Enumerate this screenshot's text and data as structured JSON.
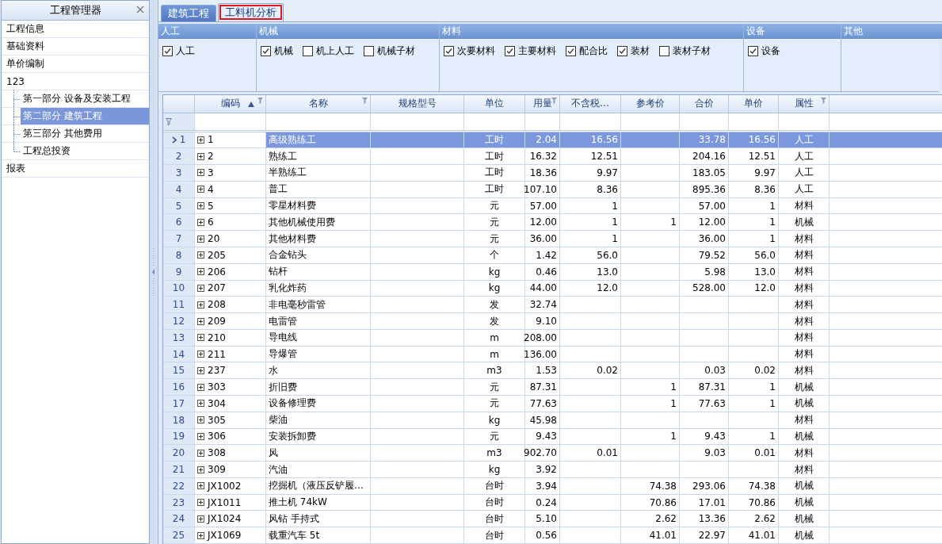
{
  "tree": {
    "title": "工程管理器",
    "items": [
      {
        "label": "工程信息",
        "selected": false
      },
      {
        "label": "基础资料",
        "selected": false
      },
      {
        "label": "单价编制",
        "selected": false
      },
      {
        "label": "123",
        "selected": false,
        "children": [
          {
            "label": "第一部分 设备及安装工程",
            "selected": false
          },
          {
            "label": "第二部分 建筑工程",
            "selected": true
          },
          {
            "label": "第三部分 其他费用",
            "selected": false
          },
          {
            "label": "工程总投资",
            "selected": false
          }
        ]
      },
      {
        "label": "报表",
        "selected": false
      }
    ]
  },
  "tabs": [
    {
      "label": "建筑工程",
      "selected": false,
      "highlighted": false
    },
    {
      "label": "工料机分析",
      "selected": true,
      "highlighted": true
    }
  ],
  "filter_groups": [
    {
      "title": "人工",
      "options": [
        {
          "label": "人工",
          "checked": true
        }
      ]
    },
    {
      "title": "机械",
      "options": [
        {
          "label": "机械",
          "checked": true
        },
        {
          "label": "机上人工",
          "checked": false
        },
        {
          "label": "机械子材",
          "checked": false
        }
      ]
    },
    {
      "title": "材料",
      "options": [
        {
          "label": "次要材料",
          "checked": true
        },
        {
          "label": "主要材料",
          "checked": true
        },
        {
          "label": "配合比",
          "checked": true
        },
        {
          "label": "装材",
          "checked": true
        },
        {
          "label": "装材子材",
          "checked": false
        }
      ]
    },
    {
      "title": "设备",
      "options": [
        {
          "label": "设备",
          "checked": true
        }
      ]
    },
    {
      "title": "其他"
    }
  ],
  "table": {
    "columns": [
      {
        "label": "编码",
        "sorted": true,
        "filter": true
      },
      {
        "label": "名称",
        "sorted": false,
        "filter": true
      },
      {
        "label": "规格型号",
        "sorted": false,
        "filter": false
      },
      {
        "label": "单位",
        "sorted": false,
        "filter": false
      },
      {
        "label": "用量",
        "sorted": false,
        "filter": true
      },
      {
        "label": "不含税…",
        "sorted": false,
        "filter": false
      },
      {
        "label": "参考价",
        "sorted": false,
        "filter": false
      },
      {
        "label": "合价",
        "sorted": false,
        "filter": false
      },
      {
        "label": "单价",
        "sorted": false,
        "filter": false
      },
      {
        "label": "属性",
        "sorted": false,
        "filter": true
      }
    ],
    "rows": [
      {
        "number": "1",
        "selected": true,
        "code": "1",
        "name": "高级熟练工",
        "unit": "工时",
        "quantity": "2.04",
        "price_excl_tax": "16.56",
        "total": "33.78",
        "unit_price": "16.56",
        "attribute": "人工"
      },
      {
        "number": "2",
        "selected": false,
        "code": "2",
        "name": "熟练工",
        "unit": "工时",
        "quantity": "16.32",
        "price_excl_tax": "12.51",
        "total": "204.16",
        "unit_price": "12.51",
        "attribute": "人工"
      },
      {
        "number": "3",
        "selected": false,
        "code": "3",
        "name": "半熟练工",
        "unit": "工时",
        "quantity": "18.36",
        "price_excl_tax": "9.97",
        "total": "183.05",
        "unit_price": "9.97",
        "attribute": "人工"
      },
      {
        "number": "4",
        "selected": false,
        "code": "4",
        "name": "普工",
        "unit": "工时",
        "quantity": "107.10",
        "price_excl_tax": "8.36",
        "total": "895.36",
        "unit_price": "8.36",
        "attribute": "人工"
      },
      {
        "number": "5",
        "selected": false,
        "code": "5",
        "name": "零星材料费",
        "unit": "元",
        "quantity": "57.00",
        "price_excl_tax": "1",
        "total": "57.00",
        "unit_price": "1",
        "attribute": "材料"
      },
      {
        "number": "6",
        "selected": false,
        "code": "6",
        "name": "其他机械使用费",
        "unit": "元",
        "quantity": "12.00",
        "price_excl_tax": "1",
        "reference_price": "1",
        "total": "12.00",
        "unit_price": "1",
        "attribute": "机械"
      },
      {
        "number": "7",
        "selected": false,
        "code": "20",
        "name": "其他材料费",
        "unit": "元",
        "quantity": "36.00",
        "price_excl_tax": "1",
        "total": "36.00",
        "unit_price": "1",
        "attribute": "材料"
      },
      {
        "number": "8",
        "selected": false,
        "code": "205",
        "name": "合金钻头",
        "unit": "个",
        "quantity": "1.42",
        "price_excl_tax": "56.0",
        "total": "79.52",
        "unit_price": "56.0",
        "attribute": "材料"
      },
      {
        "number": "9",
        "selected": false,
        "code": "206",
        "name": "钻杆",
        "unit": "kg",
        "quantity": "0.46",
        "price_excl_tax": "13.0",
        "total": "5.98",
        "unit_price": "13.0",
        "attribute": "材料"
      },
      {
        "number": "10",
        "selected": false,
        "code": "207",
        "name": "乳化炸药",
        "unit": "kg",
        "quantity": "44.00",
        "price_excl_tax": "12.0",
        "total": "528.00",
        "unit_price": "12.0",
        "attribute": "材料"
      },
      {
        "number": "11",
        "selected": false,
        "code": "208",
        "name": "非电毫秒雷管",
        "unit": "发",
        "quantity": "32.74",
        "attribute": "材料"
      },
      {
        "number": "12",
        "selected": false,
        "code": "209",
        "name": "电雷管",
        "unit": "发",
        "quantity": "9.10",
        "attribute": "材料"
      },
      {
        "number": "13",
        "selected": false,
        "code": "210",
        "name": "导电线",
        "unit": "m",
        "quantity": "208.00",
        "attribute": "材料"
      },
      {
        "number": "14",
        "selected": false,
        "code": "211",
        "name": "导爆管",
        "unit": "m",
        "quantity": "136.00",
        "attribute": "材料"
      },
      {
        "number": "15",
        "selected": false,
        "code": "237",
        "name": "水",
        "unit": "m3",
        "quantity": "1.53",
        "price_excl_tax": "0.02",
        "total": "0.03",
        "unit_price": "0.02",
        "attribute": "材料"
      },
      {
        "number": "16",
        "selected": false,
        "code": "303",
        "name": "折旧费",
        "unit": "元",
        "quantity": "87.31",
        "reference_price": "1",
        "total": "87.31",
        "unit_price": "1",
        "attribute": "机械"
      },
      {
        "number": "17",
        "selected": false,
        "code": "304",
        "name": "设备修理费",
        "unit": "元",
        "quantity": "77.63",
        "reference_price": "1",
        "total": "77.63",
        "unit_price": "1",
        "attribute": "机械"
      },
      {
        "number": "18",
        "selected": false,
        "code": "305",
        "name": "柴油",
        "unit": "kg",
        "quantity": "45.98",
        "attribute": "材料"
      },
      {
        "number": "19",
        "selected": false,
        "code": "306",
        "name": "安装拆卸费",
        "unit": "元",
        "quantity": "9.43",
        "reference_price": "1",
        "total": "9.43",
        "unit_price": "1",
        "attribute": "机械"
      },
      {
        "number": "20",
        "selected": false,
        "code": "308",
        "name": "风",
        "unit": "m3",
        "quantity": "902.70",
        "price_excl_tax": "0.01",
        "total": "9.03",
        "unit_price": "0.01",
        "attribute": "材料"
      },
      {
        "number": "21",
        "selected": false,
        "code": "309",
        "name": "汽油",
        "unit": "kg",
        "quantity": "3.92",
        "attribute": "材料"
      },
      {
        "number": "22",
        "selected": false,
        "code": "JX1002",
        "name": "挖掘机（液压反铲履…",
        "unit": "台时",
        "quantity": "3.94",
        "reference_price": "74.38",
        "total": "293.06",
        "unit_price": "74.38",
        "attribute": "机械"
      },
      {
        "number": "23",
        "selected": false,
        "code": "JX1011",
        "name": "推土机 74kW",
        "unit": "台时",
        "quantity": "0.24",
        "reference_price": "70.86",
        "total": "17.01",
        "unit_price": "70.86",
        "attribute": "机械"
      },
      {
        "number": "24",
        "selected": false,
        "code": "JX1024",
        "name": "风钻 手持式",
        "unit": "台时",
        "quantity": "5.10",
        "reference_price": "2.62",
        "total": "13.36",
        "unit_price": "2.62",
        "attribute": "机械"
      },
      {
        "number": "25",
        "selected": false,
        "code": "JX1069",
        "name": "载重汽车 5t",
        "unit": "台时",
        "quantity": "0.56",
        "reference_price": "41.01",
        "total": "22.97",
        "unit_price": "41.01",
        "attribute": "机械"
      }
    ]
  }
}
